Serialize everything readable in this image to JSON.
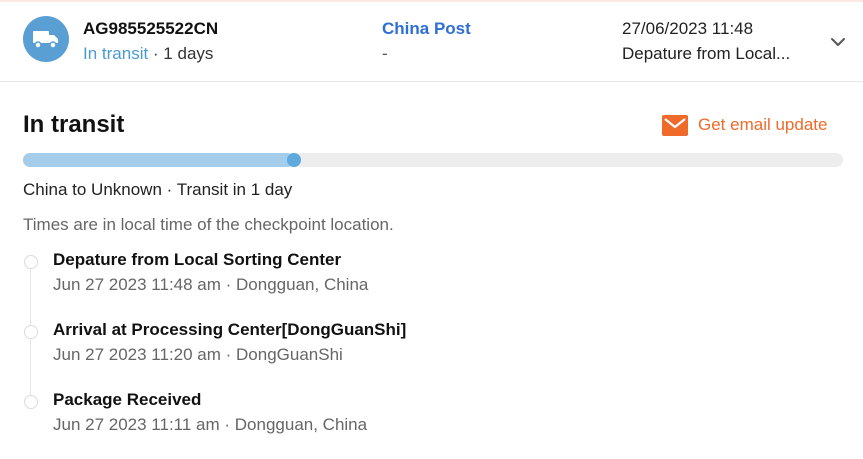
{
  "header": {
    "carrier_icon": "truck-icon",
    "tracking_number": "AG985525522CN",
    "status_text": "In transit",
    "status_suffix": " · 1 days",
    "carrier_name": "China Post",
    "carrier_sub": "-",
    "latest_time": "27/06/2023 11:48",
    "latest_desc": "Depature from Local...",
    "expand_icon": "chevron-down-icon"
  },
  "main": {
    "title": "In transit",
    "email_icon": "mail-icon",
    "email_label": "Get email update",
    "progress_fraction": 0.33,
    "route_text": "China to Unknown · Transit in 1 day",
    "timezone_note": "Times are in local time of the checkpoint location."
  },
  "events": [
    {
      "title": "Depature from Local Sorting Center",
      "meta": "Jun 27 2023 11:48 am · Dongguan, China"
    },
    {
      "title": "Arrival at Processing Center[DongGuanShi]",
      "meta": "Jun 27 2023 11:20 am · DongGuanShi"
    },
    {
      "title": "Package Received",
      "meta": "Jun 27 2023 11:11 am · Dongguan, China"
    }
  ],
  "colors": {
    "accent_blue": "#4a9ad4",
    "carrier_blue": "#2f6fd3",
    "email_orange": "#f06a2a",
    "progress_fill": "#a4cdeb",
    "progress_knob": "#5ea9de"
  }
}
